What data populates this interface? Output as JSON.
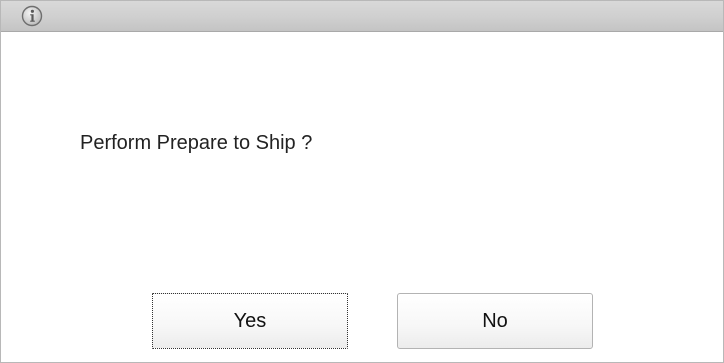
{
  "dialog": {
    "icon": "info-icon",
    "message": "Perform Prepare to Ship ?",
    "buttons": {
      "yes_label": "Yes",
      "no_label": "No"
    },
    "focused_button": "yes"
  }
}
